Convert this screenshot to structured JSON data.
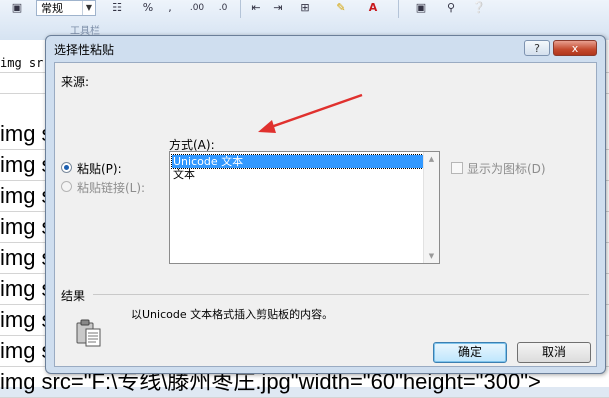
{
  "toolbar": {
    "font_combo": "常规",
    "percent": "%",
    "comma": ",",
    "group_label": "工具栏"
  },
  "sheet": {
    "first_row_text": "img sr",
    "row_text": "img s",
    "last_row_text": "img src=\"F:\\专线\\滕州枣庄.jpg\"width=\"60\"height=\"300\">"
  },
  "dialog": {
    "title": "选择性粘贴",
    "help_label": "?",
    "close_label": "x",
    "source_label": "来源:",
    "format_label": "方式(A):",
    "paste_option": "粘贴(P):",
    "paste_link_option": "粘贴链接(L):",
    "list_items": [
      "Unicode 文本",
      "文本"
    ],
    "show_icon_label": "显示为图标(D)",
    "result_label": "结果",
    "result_text": "以Unicode 文本格式插入剪贴板的内容。",
    "ok_label": "确定",
    "cancel_label": "取消"
  },
  "colors": {
    "selection": "#3399ff",
    "annotation_arrow": "#e0312e"
  }
}
